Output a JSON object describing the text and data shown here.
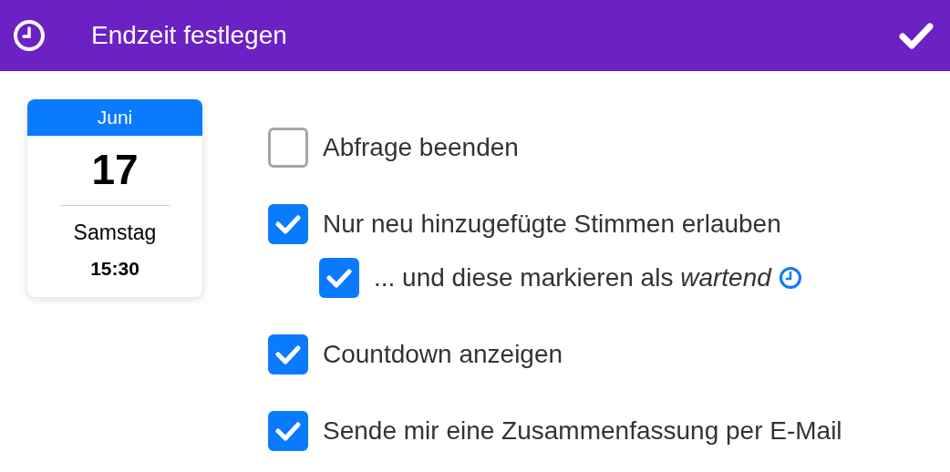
{
  "header": {
    "title": "Endzeit festlegen"
  },
  "date_card": {
    "month": "Juni",
    "day": "17",
    "weekday": "Samstag",
    "time": "15:30"
  },
  "options": [
    {
      "label": "Abfrage beenden",
      "checked": false,
      "hint_icon": false
    },
    {
      "label": "Nur neu hinzugefügte Stimmen erlauben",
      "checked": true,
      "hint_icon": false,
      "children": [
        {
          "label": "... und diese markieren als *wartend*",
          "checked": true,
          "hint_icon": true
        }
      ]
    },
    {
      "label": "Countdown anzeigen",
      "checked": true,
      "hint_icon": false
    },
    {
      "label": "Sende mir eine Zusammenfassung per E-Mail",
      "checked": true,
      "hint_icon": false
    }
  ]
}
